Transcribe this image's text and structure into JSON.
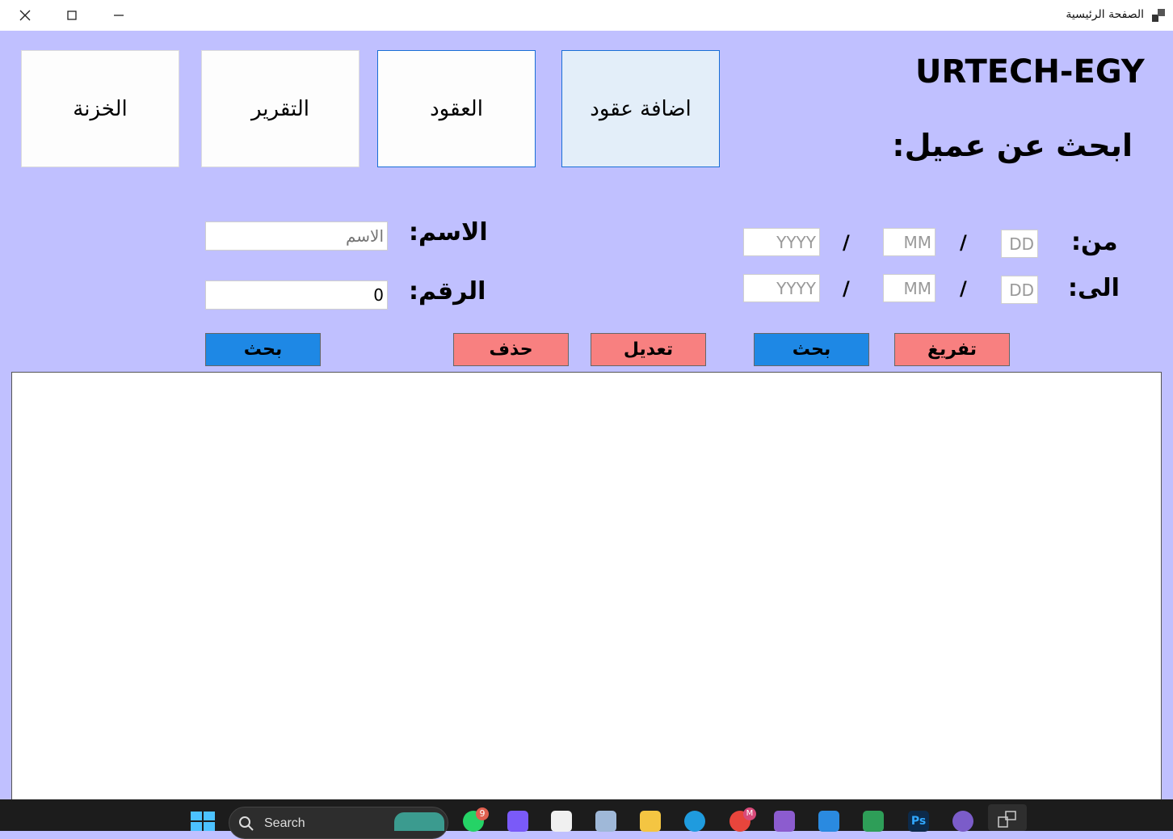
{
  "window": {
    "title": "الصفحة الرئيسية"
  },
  "nav": {
    "treasury": "الخزنة",
    "reports": "التقرير",
    "contracts": "العقود",
    "add_contracts": "اضافة عقود"
  },
  "brand": "URTECH-EGY",
  "search_title": "ابحث عن عميل:",
  "name_label": "الاسم:",
  "name_placeholder": "الاسم",
  "number_label": "الرقم:",
  "number_value": "0",
  "from_label": "من:",
  "to_label": "الى:",
  "date": {
    "yyyy": "YYYY",
    "mm": "MM",
    "dd": "DD",
    "sep": "/"
  },
  "buttons": {
    "search_left": "بحث",
    "delete": "حذف",
    "edit": "تعديل",
    "search_right": "بحث",
    "clear": "تفريغ"
  },
  "taskbar": {
    "search": "Search",
    "whatsapp_badge": "9",
    "chrome_badge": "M"
  },
  "colors": {
    "background": "#c0c0ff",
    "blue_button": "#1e88e5",
    "red_button": "#f88080"
  }
}
